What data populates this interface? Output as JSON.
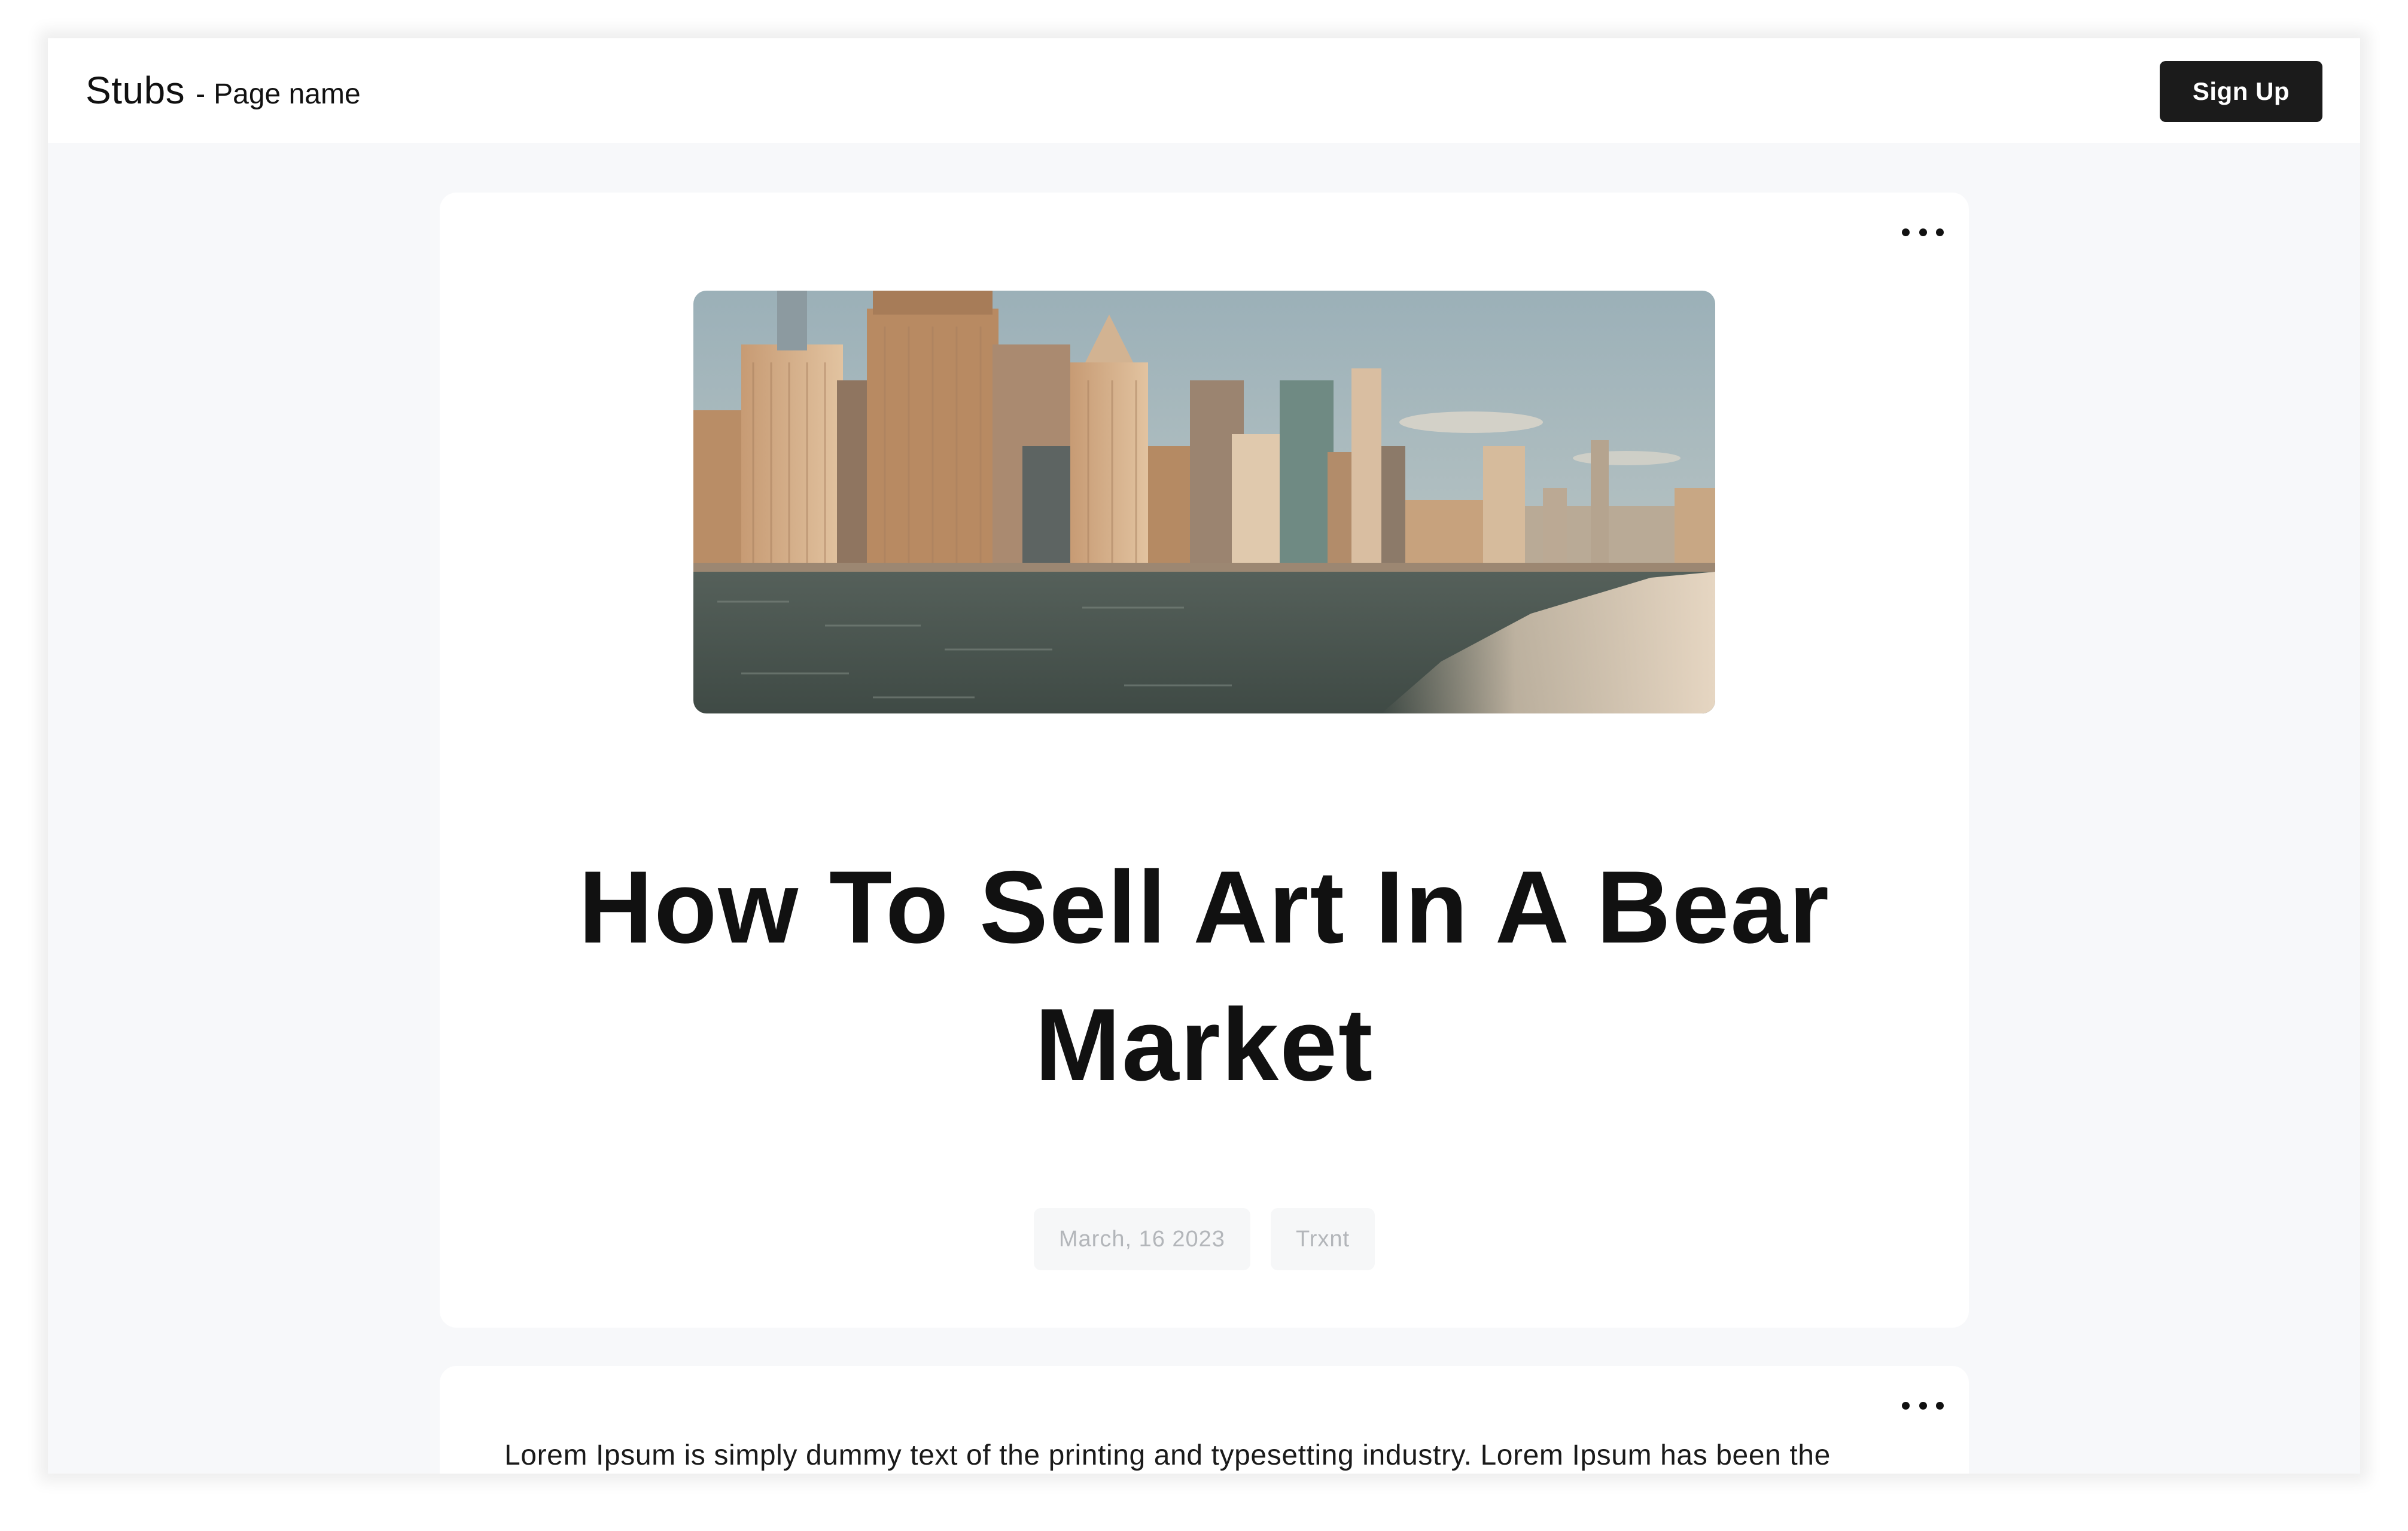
{
  "header": {
    "brand_name": "Stubs",
    "separator": "-",
    "page_name": "Page name",
    "signup_label": "Sign Up"
  },
  "hero_post": {
    "title": "How To Sell Art In A Bear Market",
    "date": "March, 16 2023",
    "author": "Trxnt",
    "more_icon": "more-horizontal-icon"
  },
  "body_post": {
    "text": "Lorem Ipsum is simply dummy text of the printing and typesetting industry. Lorem Ipsum has been the",
    "more_icon": "more-horizontal-icon"
  },
  "colors": {
    "page_background": "#f7f8fa",
    "card_background": "#ffffff",
    "button_background": "#1b1b1b",
    "button_text": "#ffffff",
    "chip_background": "#f6f7f8",
    "chip_text": "#b3b6ba",
    "title_text": "#111111"
  }
}
